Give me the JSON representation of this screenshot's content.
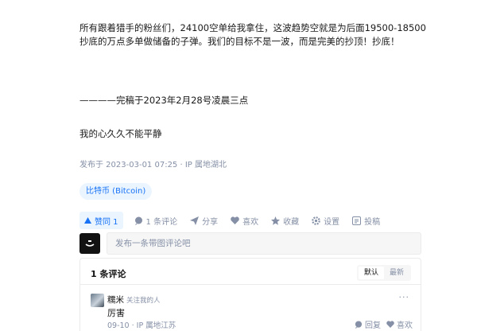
{
  "article": {
    "paragraph1": "所有跟着猎手的粉丝们，24100空单给我拿住，这波趋势空就是为后面19500-18500抄底的万点多单做储备的子弹。我们的目标不是一波，而是完美的抄顶！抄底！",
    "paragraph2": "————完稿于2023年2月28号凌晨三点",
    "paragraph3": "我的心久久不能平静",
    "meta": "发布于 2023-03-01 07:25 · IP 属地湖北",
    "tag": "比特币 (Bitcoin)"
  },
  "actions": {
    "upvote": "赞同 1",
    "comment": "1 条评论",
    "share": "分享",
    "like": "喜欢",
    "favorite": "收藏",
    "settings": "设置",
    "submit": "投稿"
  },
  "composer": {
    "placeholder": "发布一条带图评论吧"
  },
  "comments": {
    "title": "1 条评论",
    "sort_default": "默认",
    "sort_latest": "最新",
    "items": [
      {
        "author": "糯米",
        "note": "关注我的人",
        "text": "厉害",
        "meta": "09-10 · IP 属地江苏",
        "reply": "回复",
        "like": "喜欢",
        "more": "···"
      }
    ]
  },
  "colors": {
    "accent": "#1772f6",
    "muted": "#8590a6"
  }
}
